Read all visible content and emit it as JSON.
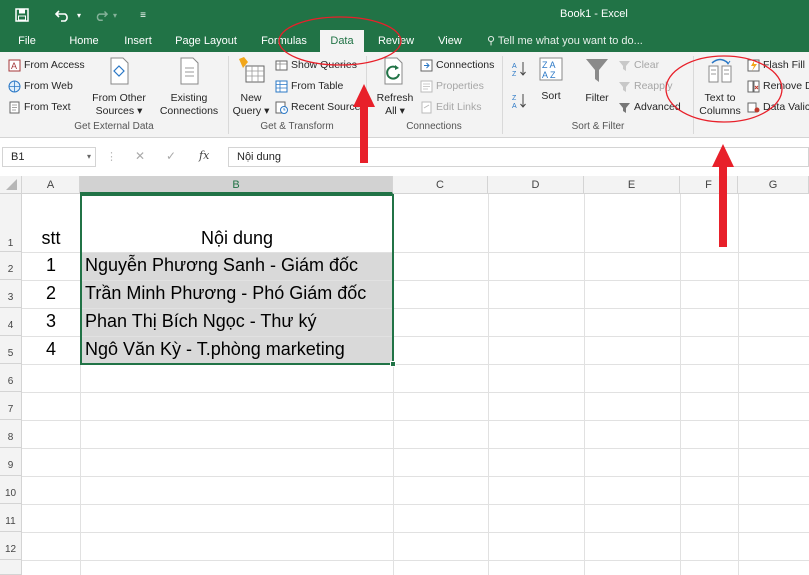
{
  "window": {
    "title": "Book1 - Excel"
  },
  "tabs": [
    {
      "label": "File"
    },
    {
      "label": "Home"
    },
    {
      "label": "Insert"
    },
    {
      "label": "Page Layout"
    },
    {
      "label": "Formulas"
    },
    {
      "label": "Data"
    },
    {
      "label": "Review"
    },
    {
      "label": "View"
    }
  ],
  "tell_me": "Tell me what you want to do...",
  "ribbon": {
    "get_external": {
      "from_access": "From Access",
      "from_web": "From Web",
      "from_text": "From Text",
      "from_other_l1": "From Other",
      "from_other_l2": "Sources",
      "existing_l1": "Existing",
      "existing_l2": "Connections",
      "label": "Get External Data"
    },
    "get_transform": {
      "new_query_l1": "New",
      "new_query_l2": "Query",
      "show_queries": "Show Queries",
      "from_table": "From Table",
      "recent_sources": "Recent Sources",
      "label": "Get & Transform"
    },
    "connections": {
      "refresh_l1": "Refresh",
      "refresh_l2": "All",
      "connections": "Connections",
      "properties": "Properties",
      "edit_links": "Edit Links",
      "label": "Connections"
    },
    "sort_filter": {
      "sort": "Sort",
      "filter": "Filter",
      "clear": "Clear",
      "reapply": "Reapply",
      "advanced": "Advanced",
      "label": "Sort & Filter"
    },
    "data_tools": {
      "text_to_l1": "Text to",
      "text_to_l2": "Columns",
      "flash_fill": "Flash Fill",
      "remove_dup": "Remove D",
      "data_valid": "Data Valic"
    }
  },
  "formula_bar": {
    "name_box": "B1",
    "fx": "fx",
    "content": "Nội dung"
  },
  "columns": [
    "A",
    "B",
    "C",
    "D",
    "E",
    "F",
    "G"
  ],
  "rows": [
    "1",
    "2",
    "3",
    "4",
    "5",
    "6",
    "7",
    "8",
    "9",
    "10",
    "11",
    "12"
  ],
  "cells": {
    "a1": "stt",
    "b1": "Nội dung",
    "a2": "1",
    "b2": "Nguyễn Phương Sanh - Giám đốc",
    "a3": "2",
    "b3": "Trần Minh Phương - Phó Giám đốc",
    "a4": "3",
    "b4": "Phan Thị Bích Ngọc - Thư ký",
    "a5": "4",
    "b5": "Ngô Văn Kỳ - T.phòng marketing"
  },
  "colors": {
    "excel_green": "#217346",
    "annotation_red": "#e8202a",
    "selection_fill": "#d9d9d9"
  }
}
